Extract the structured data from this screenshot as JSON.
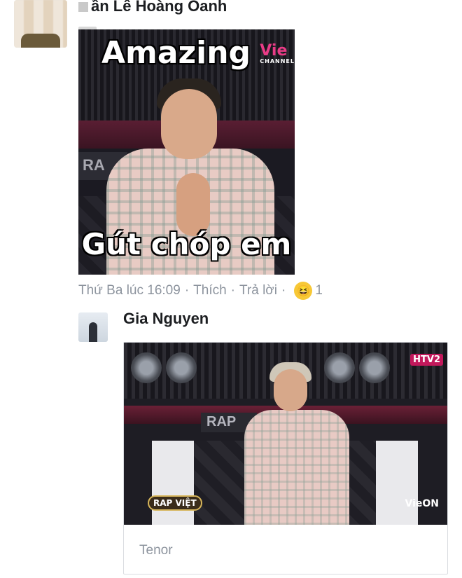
{
  "comment1": {
    "author_suffix": "ần Lê Hoàng Oanh",
    "meme": {
      "top_text": "Amazing",
      "bottom_text": "Gút chóp em",
      "logo": "Vie",
      "logo_sub": "CHANNEL",
      "sign": "RA"
    },
    "meta": {
      "time": "Thứ Ba lúc 16:09",
      "like": "Thích",
      "reply": "Trả lời",
      "reaction_icon": "haha-emoji-icon",
      "reaction_count": "1"
    }
  },
  "reply1": {
    "author": "Gia Nguyen",
    "gif": {
      "sign": "RAP",
      "channel": "HTV2",
      "show_logo": "RAP VIỆT",
      "brand": "VieON"
    },
    "provider": "Tenor"
  }
}
